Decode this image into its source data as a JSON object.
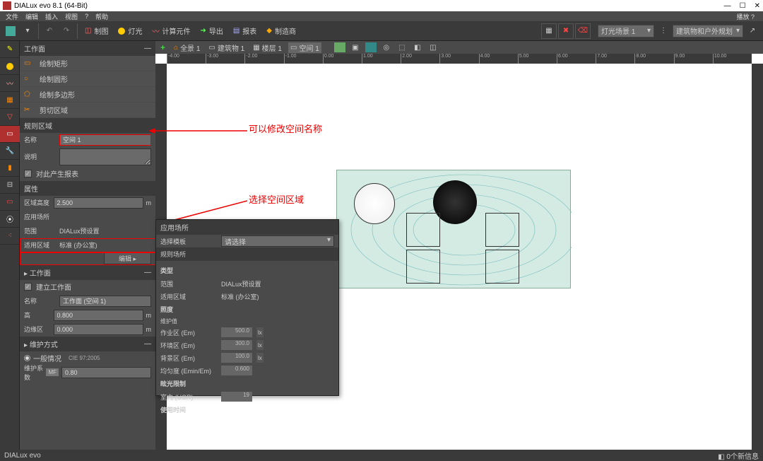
{
  "app": {
    "title": "DIALux evo 8.1  (64-Bit)"
  },
  "menu": [
    "文件",
    "编辑",
    "插入",
    "视图",
    "?",
    "帮助"
  ],
  "menu_right": "播放 ?",
  "toolbar_tabs": [
    {
      "icon": "layout",
      "label": "制图"
    },
    {
      "icon": "bulb",
      "label": "灯光"
    },
    {
      "icon": "chart",
      "label": "计算元件"
    },
    {
      "icon": "export",
      "label": "导出"
    },
    {
      "icon": "table",
      "label": "报表"
    },
    {
      "icon": "vendor",
      "label": "制造商"
    }
  ],
  "toolbar_right": {
    "scene": "灯光场景 1",
    "view": "建筑物和户外规划"
  },
  "subtoolbar": [
    {
      "icon": "+",
      "label": "全景 1"
    },
    {
      "icon": "⌂",
      "label": "建筑物 1"
    },
    {
      "icon": "▦",
      "label": "楼层 1"
    },
    {
      "icon": "▭",
      "label": "空间 1"
    }
  ],
  "ruler_h": [
    "-4.00",
    "-3.00",
    "-2.00",
    "-1.00",
    "0.00",
    "1.00",
    "2.00",
    "3.00",
    "4.00",
    "5.00",
    "6.00",
    "7.00",
    "8.00",
    "9.00",
    "10.00"
  ],
  "side": {
    "section1": "工作面",
    "tools": [
      "绘制矩形",
      "绘制圆形",
      "绘制多边形",
      "剪切区域"
    ],
    "section2": "规则区域",
    "name_label": "名称",
    "name_value": "空间 1",
    "desc_label": "说明",
    "check1": "对此产生报表",
    "section3": "属性",
    "height_label": "区域高度",
    "height_value": "2.500",
    "height_unit": "m",
    "usage_label": "应用场所",
    "scope_label": "范围",
    "scope_value": "DIALux预设置",
    "zone_label": "适用区域",
    "zone_value": "标准 (办公室)",
    "edit_btn": "编辑   ▸",
    "section4": "工作面",
    "check2": "建立工作面",
    "name2_label": "名称",
    "name2_value": "工作面 (空间 1)",
    "h_label": "高",
    "h_value": "0.800",
    "h_unit": "m",
    "edge_label": "边缘区",
    "edge_value": "0.000",
    "edge_unit": "m",
    "section5": "维护方式",
    "radio1": "一般情况",
    "radio1_sub": "CIE 97:2005",
    "mf_label": "维护系数",
    "mf_badge": "MF",
    "mf_value": "0.80"
  },
  "popup": {
    "header": "应用场所",
    "template_label": "选择模板",
    "template_value": "请选择",
    "section": "规则场所",
    "type": "类型",
    "scope_label": "范围",
    "scope_value": "DIALux预设置",
    "zone_label": "适用区域",
    "zone_value": "标准 (办公室)",
    "illum": "照度",
    "maint": "维护值",
    "worker_label": "作业区 (Em)",
    "worker_val": "500.0",
    "worker_u": "lx",
    "surround_label": "环境区 (Em)",
    "surround_val": "300.0",
    "surround_u": "lx",
    "back_label": "背景区 (Em)",
    "back_val": "100.0",
    "back_u": "lx",
    "unif_label": "均匀度 (Emin/Em)",
    "unif_val": "0.600",
    "glare": "眩光限制",
    "ugr_label": "室内 (UGR)",
    "ugr_val": "19",
    "usage": "使用时间"
  },
  "annotations": {
    "a1": "可以修改空间名称",
    "a2": "选择空间区域"
  },
  "status": {
    "left": "DIALux evo",
    "right": "◧ 0个新信息"
  }
}
